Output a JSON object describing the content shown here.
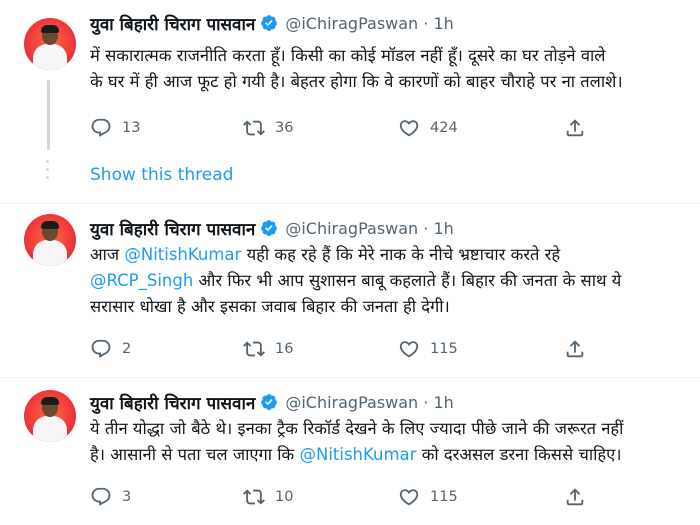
{
  "tweets": [
    {
      "name": "युवा बिहारी चिराग पासवान",
      "handle": "@iChiragPaswan · 1h",
      "lines": [
        "में सकारात्मक राजनीति करता हूँ। किसी का कोई मॉडल नहीं हूँ। दूसरे का घर तोड़ने वाले",
        "के घर में ही आज फूट हो गयी है। बेहतर होगा कि वे कारणों को बाहर चौराहे पर ना तलाशे।"
      ],
      "replies": "13",
      "retweets": "36",
      "likes": "424"
    },
    {
      "name": "युवा बिहारी चिराग पासवान",
      "handle": "@iChiragPaswan · 1h",
      "line1_a": "आज ",
      "line1_mention": "@NitishKumar",
      "line1_b": " यही कह रहे हैं कि मेरे नाक के नीचे भ्रष्टाचार करते रहे",
      "line2_mention": "@RCP_Singh",
      "line2_b": " और फिर भी आप सुशासन बाबू कहलाते हैं। बिहार की जनता के साथ ये",
      "line3": "सरासार धोखा है और इसका जवाब बिहार की जनता ही देगी।",
      "replies": "2",
      "retweets": "16",
      "likes": "115"
    },
    {
      "name": "युवा बिहारी चिराग पासवान",
      "handle": "@iChiragPaswan · 1h",
      "line1": "ये तीन योद्धा जो बैठे थे। इनका ट्रैक रिकॉर्ड देखने के लिए ज्यादा पीछे जाने की जरूरत नहीं",
      "line2_a": "है। आसानी से पता चल जाएगा कि ",
      "line2_mention": "@NitishKumar",
      "line2_b": " को दरअसल डरना किससे चाहिए।",
      "replies": "3",
      "retweets": "10",
      "likes": "115"
    }
  ],
  "show_thread": "Show this thread",
  "colors": {
    "link": "#1d9bf0",
    "muted": "#536471",
    "text": "#0f1419",
    "verified": "#1d9bf0"
  },
  "icons": [
    "reply-icon",
    "retweet-icon",
    "like-icon",
    "share-icon",
    "verified-badge-icon"
  ]
}
